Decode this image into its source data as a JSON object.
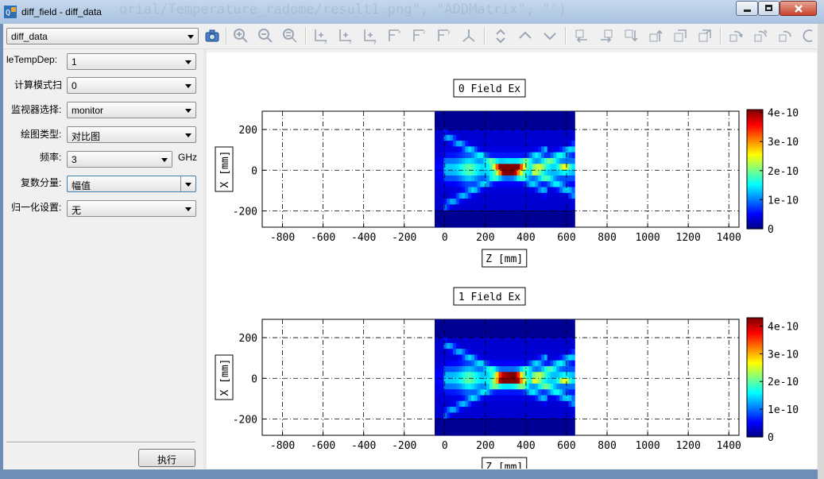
{
  "window": {
    "title": "diff_field - diff_data",
    "background_text": "orial/Temperature_radome/result1.png\", \"ADDMatrix\", \"\")"
  },
  "toolbar": {
    "dataset_select": "diff_data",
    "icons": [
      "camera-icon",
      "zoom-in-icon",
      "zoom-out-icon",
      "zoom-fit-icon",
      "axis-x-add-icon",
      "axis-z-add-icon",
      "axis-y-add-icon",
      "axis-xz-icon",
      "axis-zx-icon",
      "axis-zy-icon",
      "axis-3d-icon",
      "arrow-up-icon",
      "arrow-up-outline-icon",
      "arrow-down-outline-icon",
      "move-left-icon",
      "move-right-icon",
      "move-down-icon",
      "move-up-icon",
      "view-1-icon",
      "view-2-icon",
      "rotate-cw-icon",
      "rotate-ccw-icon",
      "rotate-icon"
    ]
  },
  "panel": {
    "fields": [
      {
        "label": "leTempDep:",
        "value": "1"
      },
      {
        "label": "计算模式扫",
        "value": "0"
      },
      {
        "label": "监视器选择:",
        "value": "monitor"
      },
      {
        "label": "绘图类型:",
        "value": "对比图"
      },
      {
        "label": "频率:",
        "value": "3",
        "unit": "GHz"
      },
      {
        "label": "复数分量:",
        "value": "幅值"
      },
      {
        "label": "归一化设置:",
        "value": "无"
      }
    ],
    "run_button": "执行"
  },
  "plots": [
    {
      "title": "0 Field Ex",
      "xlabel": "Z [mm]",
      "ylabel": "X [mm]"
    },
    {
      "title": "1 Field Ex",
      "xlabel": "Z [mm]",
      "ylabel": "X [mm]"
    }
  ],
  "chart_data": [
    {
      "type": "heatmap",
      "title": "0 Field Ex",
      "xlabel": "Z [mm]",
      "ylabel": "X [mm]",
      "xlim": [
        -900,
        1450
      ],
      "ylim": [
        -280,
        290
      ],
      "xticks": [
        "-800",
        "-600",
        "-400",
        "-200",
        "0",
        "200",
        "400",
        "600",
        "800",
        "1000",
        "1200",
        "1400"
      ],
      "yticks": [
        "-200",
        "0",
        "200"
      ],
      "data_extent_z": [
        -50,
        640
      ],
      "colorbar_ticks": [
        "0",
        "1e-10",
        "2e-10",
        "3e-10",
        "4e-10"
      ],
      "colorbar_range": [
        0,
        4.1e-10
      ],
      "hotspot": {
        "z": 320,
        "x": 10
      },
      "grid": true
    },
    {
      "type": "heatmap",
      "title": "1 Field Ex",
      "xlabel": "Z [mm]",
      "ylabel": "X [mm]",
      "xlim": [
        -900,
        1450
      ],
      "ylim": [
        -280,
        290
      ],
      "xticks": [
        "-800",
        "-600",
        "-400",
        "-200",
        "0",
        "200",
        "400",
        "600",
        "800",
        "1000",
        "1200",
        "1400"
      ],
      "yticks": [
        "-200",
        "0",
        "200"
      ],
      "data_extent_z": [
        -50,
        640
      ],
      "colorbar_ticks": [
        "0",
        "1e-10",
        "2e-10",
        "3e-10",
        "4e-10"
      ],
      "colorbar_range": [
        0,
        4.3e-10
      ],
      "hotspot": {
        "z": 320,
        "x": 0
      },
      "grid": true
    }
  ]
}
